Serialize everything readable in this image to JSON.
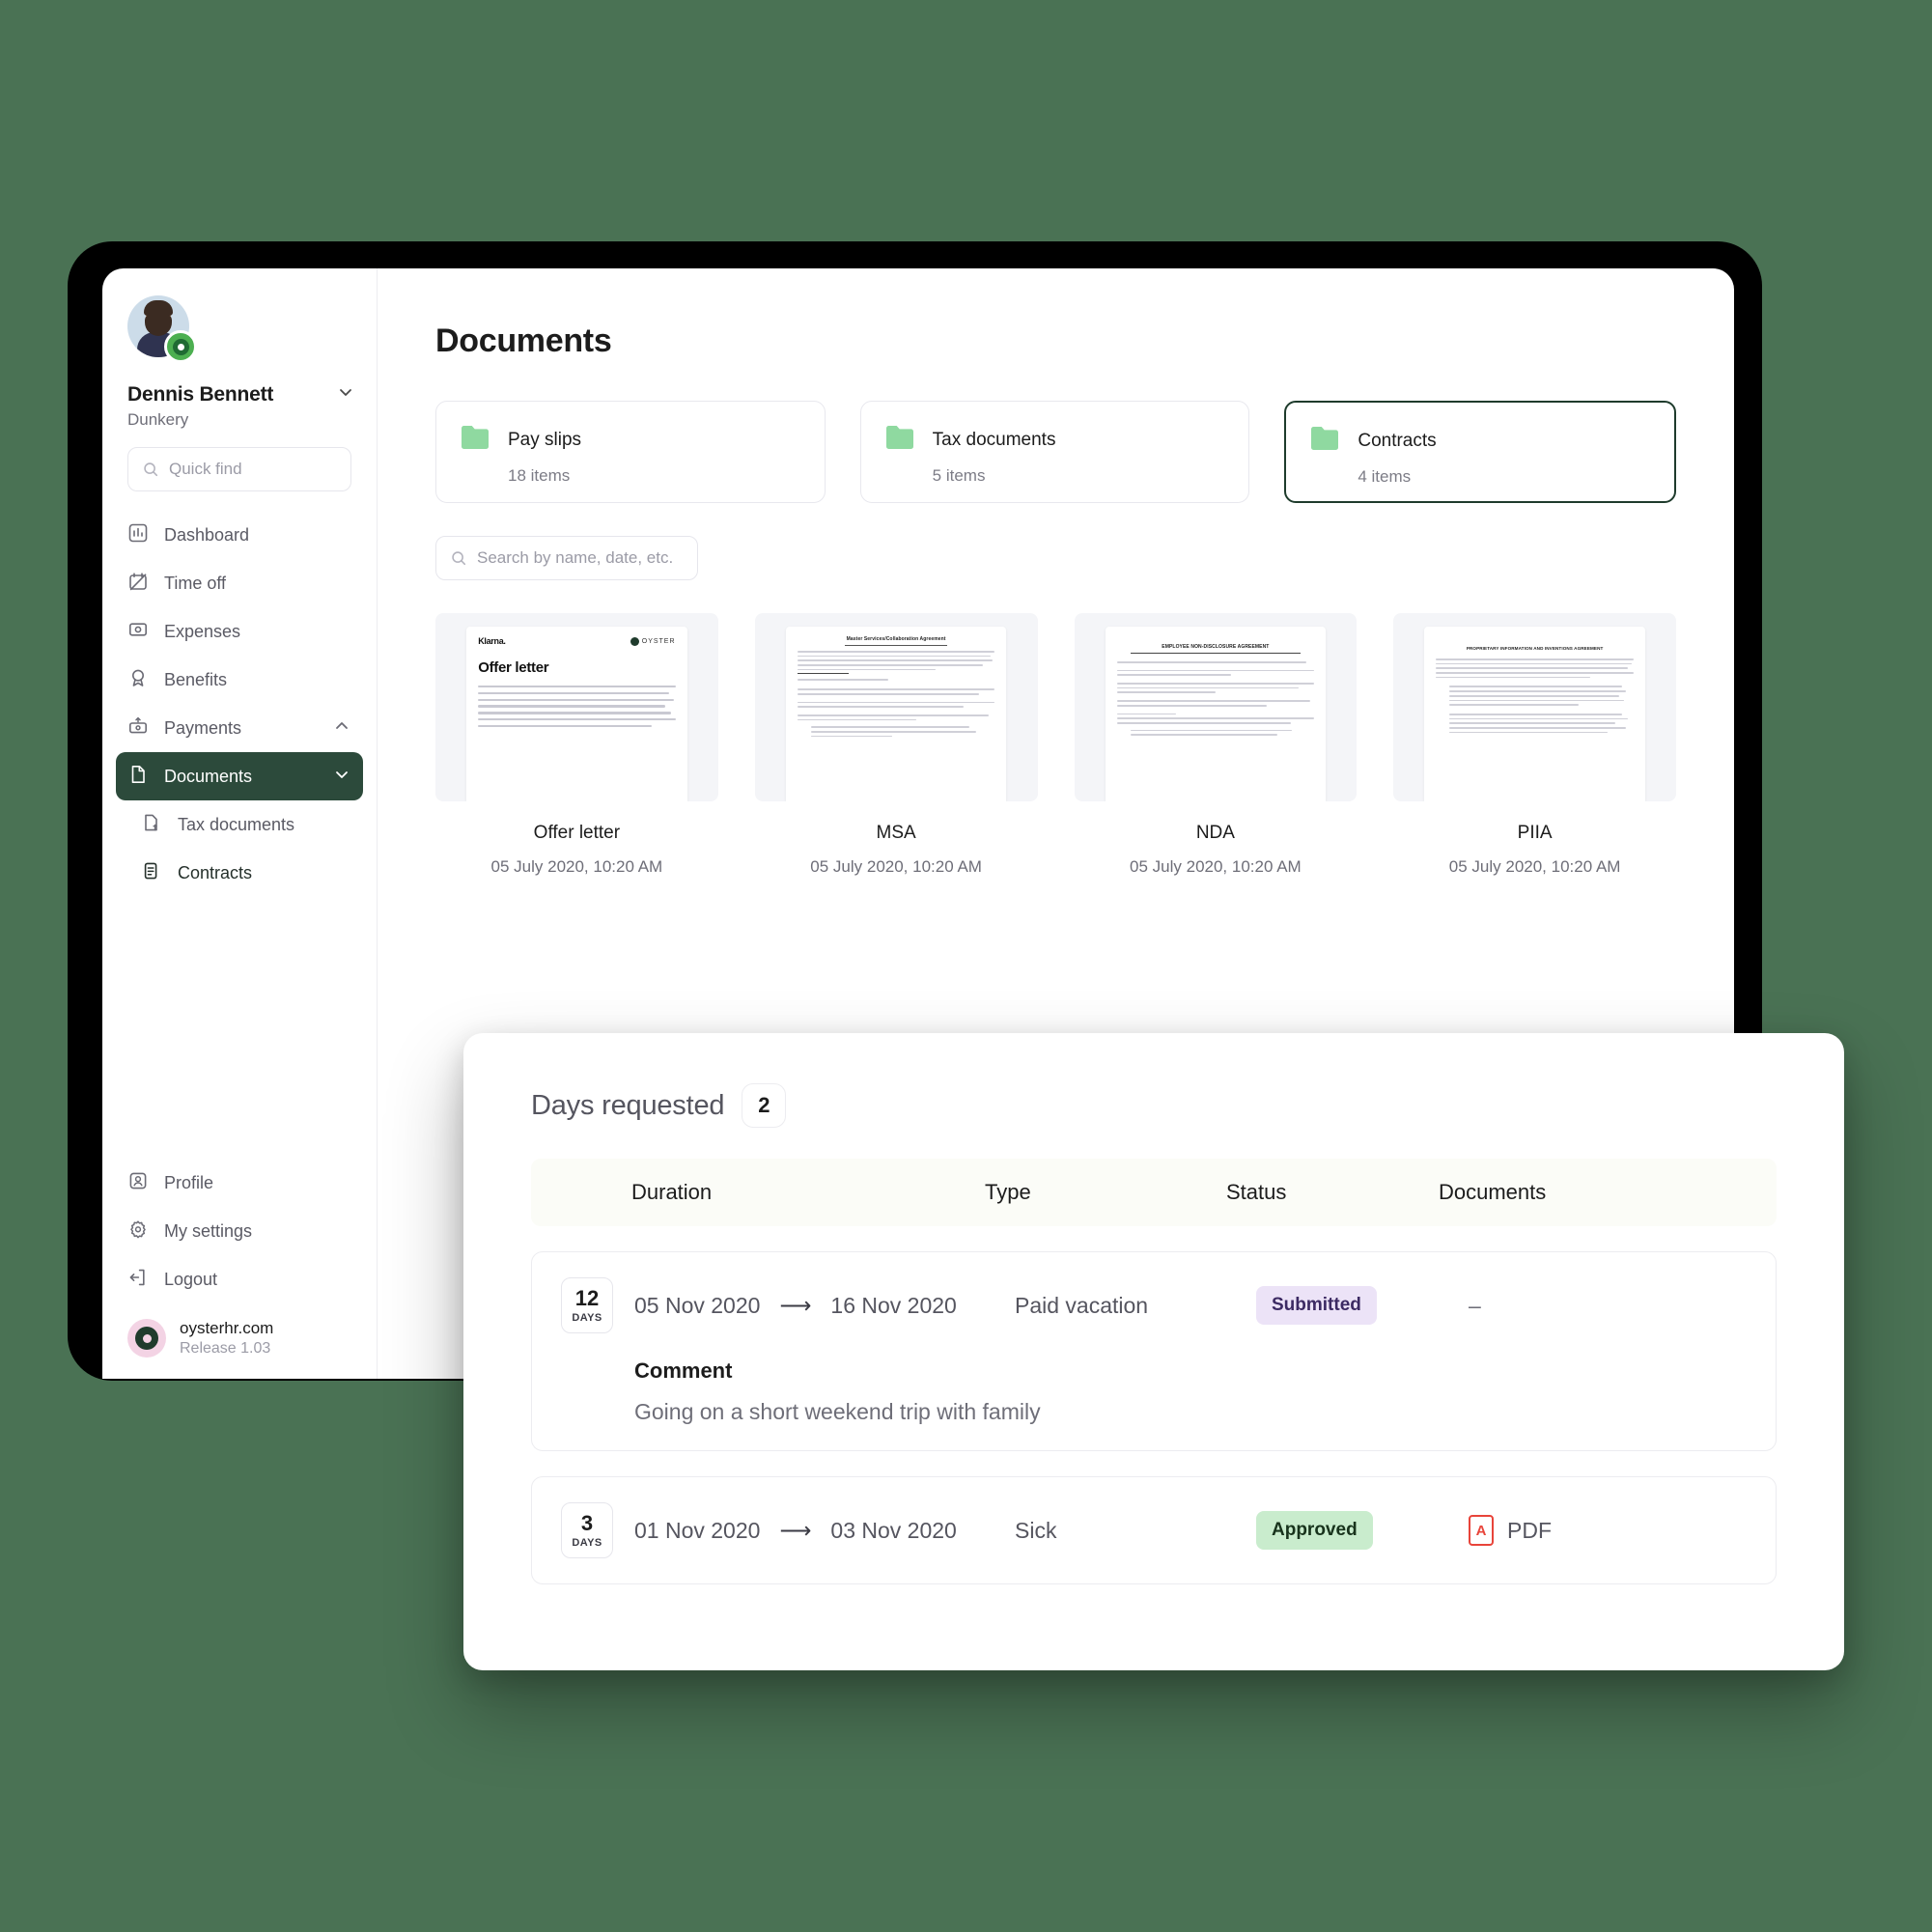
{
  "sidebar": {
    "user": {
      "name": "Dennis Bennett",
      "company": "Dunkery",
      "avatar_icon": "user-avatar",
      "badge_icon": "oyster-badge"
    },
    "quick_find_placeholder": "Quick find",
    "nav": [
      {
        "label": "Dashboard",
        "icon": "chart-bar-icon"
      },
      {
        "label": "Time off",
        "icon": "calendar-off-icon"
      },
      {
        "label": "Expenses",
        "icon": "receipt-icon"
      },
      {
        "label": "Benefits",
        "icon": "award-icon"
      },
      {
        "label": "Payments",
        "icon": "payments-icon",
        "caret": "chevron-up"
      },
      {
        "label": "Documents",
        "icon": "document-icon",
        "caret": "chevron-down",
        "active": true
      }
    ],
    "sub_nav": [
      {
        "label": "Tax documents",
        "icon": "tax-document-icon"
      },
      {
        "label": "Contracts",
        "icon": "contract-icon"
      }
    ],
    "bottom_nav": [
      {
        "label": "Profile",
        "icon": "profile-icon"
      },
      {
        "label": "My settings",
        "icon": "gear-icon"
      },
      {
        "label": "Logout",
        "icon": "logout-icon"
      }
    ],
    "brand": {
      "name": "oysterhr.com",
      "release": "Release 1.03",
      "icon": "oyster-logo"
    }
  },
  "main": {
    "title": "Documents",
    "folders": [
      {
        "name": "Pay slips",
        "count": "18 items",
        "selected": false
      },
      {
        "name": "Tax documents",
        "count": "5 items",
        "selected": false
      },
      {
        "name": "Contracts",
        "count": "4 items",
        "selected": true
      }
    ],
    "search_placeholder": "Search by name, date, etc.",
    "documents": [
      {
        "name": "Offer letter",
        "date": "05 July 2020, 10:20 AM",
        "preview_kind": "offer",
        "preview_heading": "Offer letter",
        "brand_left": "Klarna.",
        "brand_right": "OYSTER"
      },
      {
        "name": "MSA",
        "date": "05 July 2020, 10:20 AM",
        "preview_kind": "legal",
        "preview_heading": "Master Services/Collaboration Agreement"
      },
      {
        "name": "NDA",
        "date": "05 July 2020, 10:20 AM",
        "preview_kind": "legal",
        "preview_heading": "EMPLOYEE NON-DISCLOSURE AGREEMENT"
      },
      {
        "name": "PIIA",
        "date": "05 July 2020, 10:20 AM",
        "preview_kind": "legal",
        "preview_heading": "PROPRIETARY INFORMATION AND INVENTIONS AGREEMENT"
      }
    ]
  },
  "overlay": {
    "title": "Days requested",
    "count": "2",
    "columns": {
      "duration": "Duration",
      "type": "Type",
      "status": "Status",
      "documents": "Documents"
    },
    "rows": [
      {
        "days_number": "12",
        "days_label": "DAYS",
        "start": "05 Nov 2020",
        "arrow": "⟶",
        "end": "16 Nov 2020",
        "type": "Paid vacation",
        "status": "Submitted",
        "status_style": "submitted",
        "documents": "–",
        "comment_title": "Comment",
        "comment_text": "Going on a short weekend trip with family"
      },
      {
        "days_number": "3",
        "days_label": "DAYS",
        "start": "01 Nov 2020",
        "arrow": "⟶",
        "end": "03 Nov 2020",
        "type": "Sick",
        "status": "Approved",
        "status_style": "approved",
        "documents": "PDF"
      }
    ]
  },
  "colors": {
    "page_background": "#4a7254",
    "frame": "#000000",
    "accent_dark_green": "#2c4a3b",
    "folder_green": "#8fd9a0",
    "badge_submitted_bg": "#ece3f7",
    "badge_approved_bg": "#c9eccd",
    "pdf_red": "#e8443a",
    "brand_pink": "#f3d3e4"
  }
}
